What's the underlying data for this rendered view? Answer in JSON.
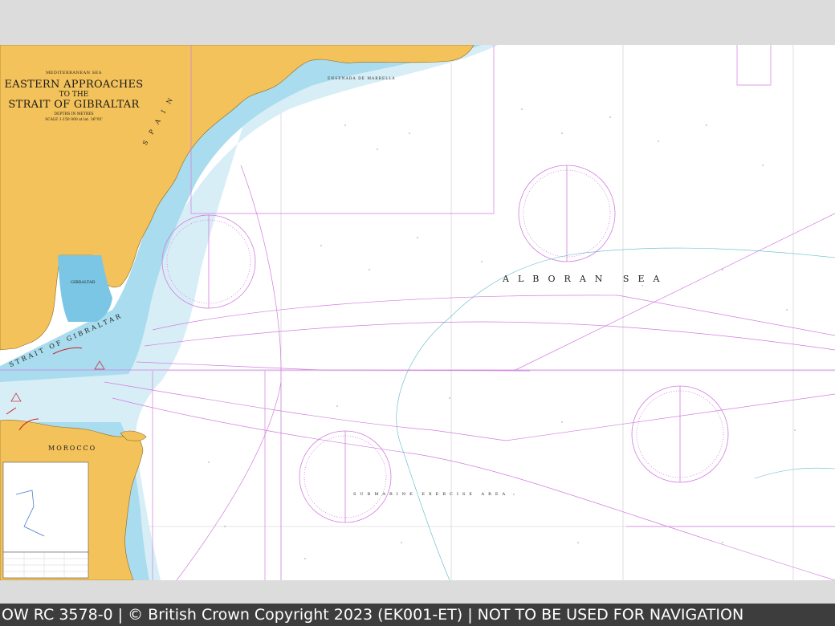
{
  "chart_title": {
    "sea": "MEDITERRANEAN SEA",
    "line1": "EASTERN APPROACHES",
    "line2": "TO THE",
    "line3": "STRAIT OF GIBRALTAR",
    "depths": "DEPTHS IN METRES",
    "scale": "SCALE 1:150 000 at lat. 36°05'"
  },
  "map_labels": {
    "alboran_sea": "ALBORAN SEA",
    "strait": "STRAIT OF GIBRALTAR",
    "gibraltar": "GIBRALTAR",
    "morocco": "MOROCCO",
    "spain": "SPAIN",
    "submarine_area": "SUBMARINE EXERCISE AREA",
    "ensenada": "ENSENADA DE MARBELLA"
  },
  "footer": {
    "text": "OW RC 3578-0 | © British Crown Copyright 2023 (EK001-ET) | NOT TO BE USED FOR NAVIGATION"
  },
  "colors": {
    "land": "#f3c25a",
    "shallow_water": "#9fd9ec",
    "mid_water": "#cfeaf6",
    "route_lines": "#d27be0",
    "frame": "#444444"
  }
}
